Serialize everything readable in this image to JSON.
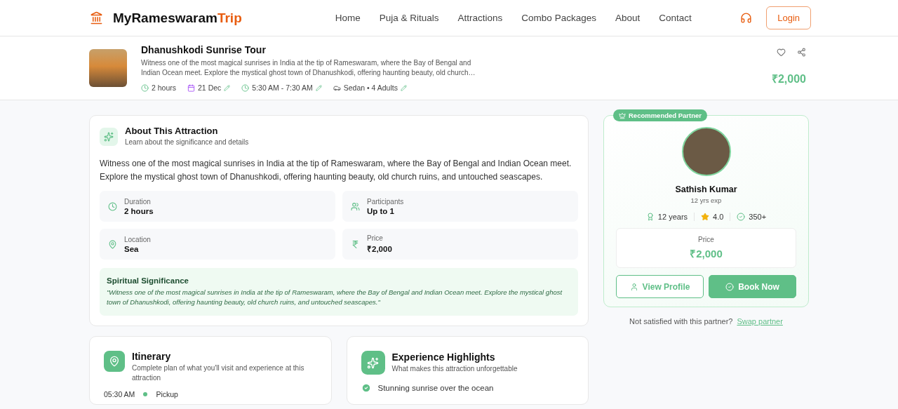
{
  "header": {
    "brand": {
      "main": "MyRameswaram",
      "accent": "Trip"
    },
    "nav": [
      {
        "label": "Home",
        "selected": false
      },
      {
        "label": "Puja & Rituals",
        "selected": false
      },
      {
        "label": "Attractions",
        "selected": false
      },
      {
        "label": "Combo Packages",
        "selected": false
      },
      {
        "label": "About",
        "selected": false
      },
      {
        "label": "Contact",
        "selected": false
      }
    ],
    "login": "Login"
  },
  "tour": {
    "title": "Dhanushkodi Sunrise Tour",
    "description": "Witness one of the most magical sunrises in India at the tip of Rameswaram, where the Bay of Bengal and Indian Ocean meet. Explore the mystical ghost town of Dhanushkodi, offering haunting beauty, old church…",
    "meta": [
      {
        "kind": "duration",
        "text": "2 hours",
        "editable": false
      },
      {
        "kind": "date",
        "text": "21 Dec",
        "editable": true
      },
      {
        "kind": "time",
        "text": "5:30 AM - 7:30 AM",
        "editable": true
      },
      {
        "kind": "vehicle",
        "text": "Sedan • 4 Adults",
        "editable": true
      }
    ],
    "price": "₹2,000"
  },
  "about": {
    "title": "About This Attraction",
    "subtitle": "Learn about the significance and details",
    "text": "Witness one of the most magical sunrises in India at the tip of Rameswaram, where the Bay of Bengal and Indian Ocean meet. Explore the mystical ghost town of Dhanushkodi, offering haunting beauty, old church ruins, and untouched seascapes.",
    "facts": [
      {
        "kind": "duration",
        "label": "Duration",
        "value": "2 hours"
      },
      {
        "kind": "participants",
        "label": "Participants",
        "value": "Up to 1"
      },
      {
        "kind": "location",
        "label": "Location",
        "value": "Sea"
      },
      {
        "kind": "price",
        "label": "Price",
        "value": "₹2,000"
      }
    ],
    "significance": {
      "title": "Spiritual Significance",
      "quote": "\"Witness one of the most magical sunrises in India at the tip of Rameswaram, where the Bay of Bengal and Indian Ocean meet. Explore the mystical ghost town of Dhanushkodi, offering haunting beauty, old church ruins, and untouched seascapes.\""
    }
  },
  "itinerary": {
    "title": "Itinerary",
    "subtitle": "Complete plan of what you'll visit and experience at this attraction",
    "steps": [
      {
        "time": "05:30 AM",
        "label": "Pickup"
      }
    ]
  },
  "highlights": {
    "title": "Experience Highlights",
    "subtitle": "What makes this attraction unforgettable",
    "items": [
      "Stunning sunrise over the ocean"
    ]
  },
  "partner": {
    "badge": "Recommended Partner",
    "name": "Sathish Kumar",
    "experience": "12 yrs exp",
    "stats": [
      {
        "kind": "years",
        "text": "12 years"
      },
      {
        "kind": "rating",
        "text": "4.0"
      },
      {
        "kind": "trips",
        "text": "350+"
      }
    ],
    "price_label": "Price",
    "price": "₹2,000",
    "view_profile": "View Profile",
    "book_now": "Book Now",
    "swap_prompt": "Not satisfied with this partner?",
    "swap_link": "Swap partner"
  }
}
